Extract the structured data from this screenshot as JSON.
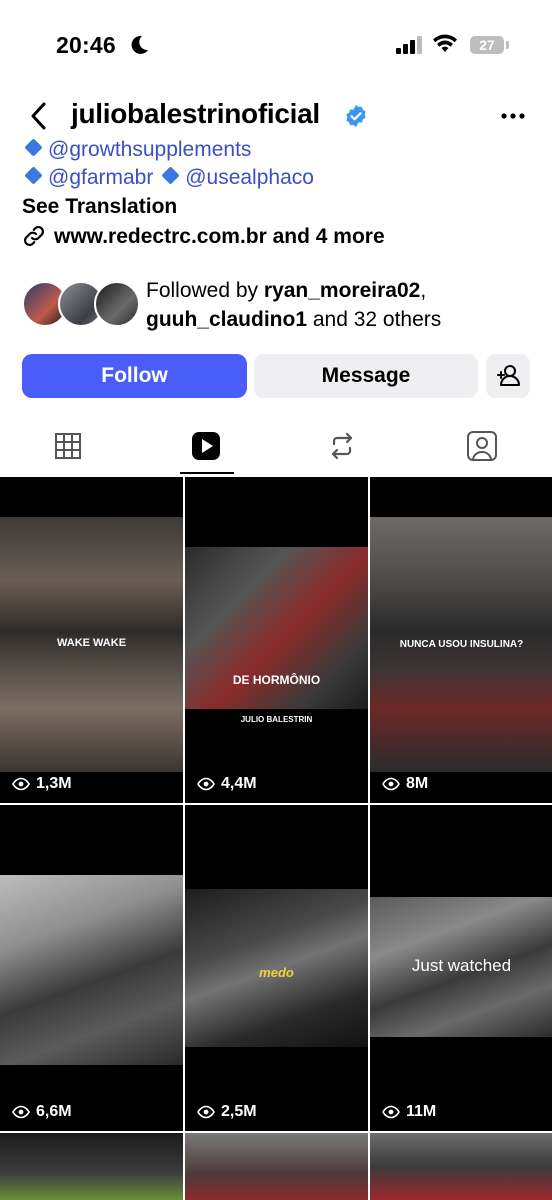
{
  "status_bar": {
    "time": "20:46",
    "battery": "27"
  },
  "header": {
    "username": "juliobalestrinoficial"
  },
  "bio": {
    "line1_link": "@growthsupplements",
    "line2_link_a": "@gfarmabr",
    "line2_link_b": "@usealphaco",
    "see_translation": "See Translation",
    "website": "www.redectrc.com.br and 4 more"
  },
  "followed_by": {
    "prefix": "Followed by ",
    "user1": "ryan_moreira02",
    "separator": ",",
    "user2": "guuh_claudino1",
    "suffix": " and 32 others"
  },
  "actions": {
    "follow": "Follow",
    "message": "Message"
  },
  "tabs": [
    "grid",
    "reels",
    "reposts",
    "tagged"
  ],
  "reels": [
    {
      "views": "1,3M",
      "overlay_text": "WAKE WAKE"
    },
    {
      "views": "4,4M",
      "overlay_text": "DE HORMÔNIO",
      "sub_text": "JULIO BALESTRIN"
    },
    {
      "views": "8M",
      "overlay_text": "NUNCA USOU INSULINA?"
    },
    {
      "views": "6,6M"
    },
    {
      "views": "2,5M",
      "overlay_text": "medo"
    },
    {
      "views": "11M",
      "overlay_text": "Just watched"
    }
  ],
  "colors": {
    "follow_blue": "#4a5df9",
    "link_blue": "#3b4fc4",
    "verified_blue": "#3897f0"
  }
}
